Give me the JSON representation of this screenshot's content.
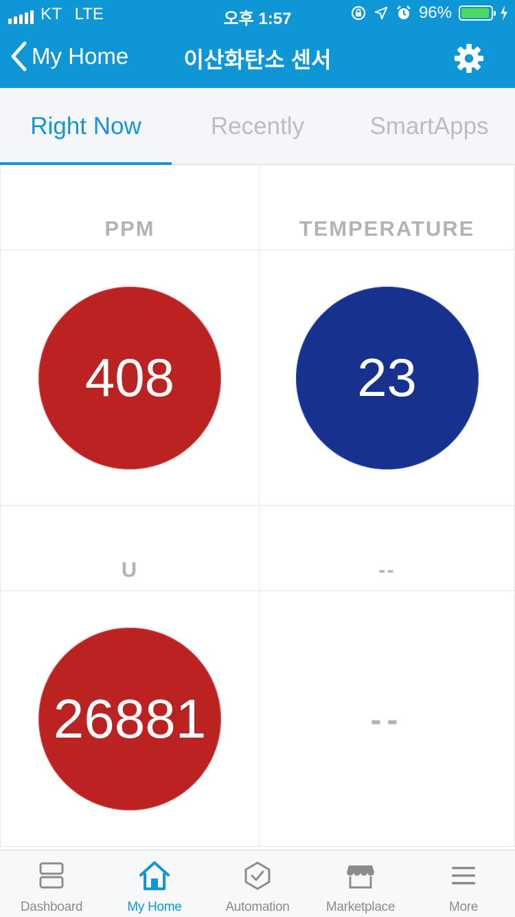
{
  "status": {
    "carrier": "KT",
    "network": "LTE",
    "time": "오후 1:57",
    "battery": "96%"
  },
  "nav": {
    "back_label": "My Home",
    "title": "이산화탄소 센서"
  },
  "tabs": [
    {
      "label": "Right Now",
      "active": true
    },
    {
      "label": "Recently",
      "active": false
    },
    {
      "label": "SmartApps",
      "active": false
    }
  ],
  "tiles": [
    {
      "label": "PPM",
      "value": "408",
      "color": "#bb2222"
    },
    {
      "label": "TEMPERATURE",
      "value": "23",
      "color": "#17328e"
    },
    {
      "label": "U",
      "value": "26881",
      "color": "#bb2222"
    },
    {
      "label": "--",
      "value": "--"
    }
  ],
  "tabbar": [
    {
      "label": "Dashboard",
      "icon": "dashboard-icon"
    },
    {
      "label": "My Home",
      "icon": "home-icon",
      "active": true
    },
    {
      "label": "Automation",
      "icon": "automation-icon"
    },
    {
      "label": "Marketplace",
      "icon": "marketplace-icon"
    },
    {
      "label": "More",
      "icon": "menu-icon"
    }
  ],
  "colors": {
    "accent": "#0f96d6",
    "tile_red": "#bb2222",
    "tile_blue": "#17328e",
    "muted": "#b3b3b3"
  }
}
